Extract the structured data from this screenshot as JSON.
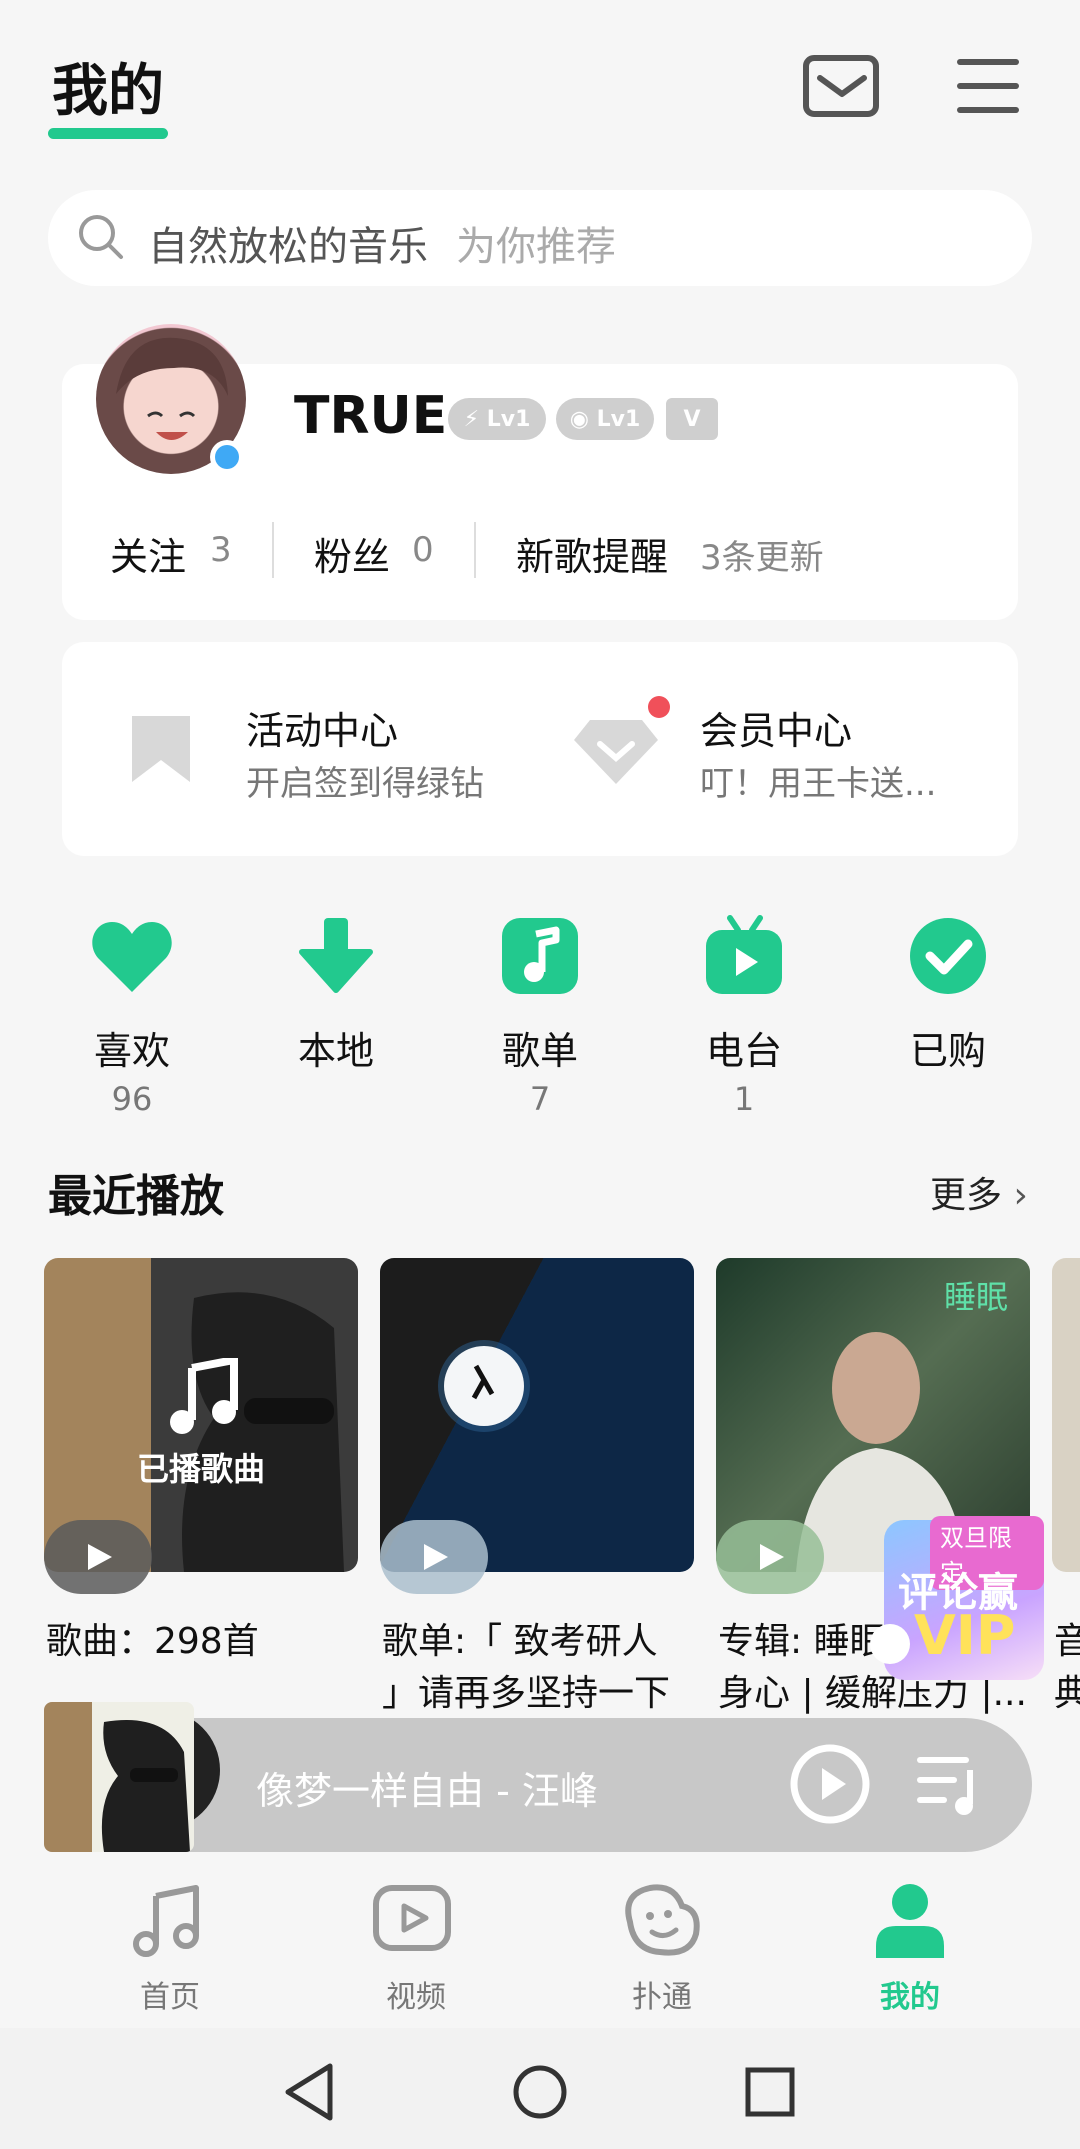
{
  "header": {
    "title": "我的"
  },
  "search": {
    "text": "自然放松的音乐",
    "hint": "为你推荐"
  },
  "profile": {
    "username": "TRUE",
    "badges": [
      "Lv1",
      "Lv1",
      "V"
    ],
    "stats": [
      {
        "label": "关注",
        "value": "3"
      },
      {
        "label": "粉丝",
        "value": "0"
      },
      {
        "label": "新歌提醒",
        "value": "3条更新"
      }
    ]
  },
  "centers": [
    {
      "title": "活动中心",
      "subtitle": "开启签到得绿钻",
      "icon": "bookmark-icon"
    },
    {
      "title": "会员中心",
      "subtitle": "叮！用王卡送...",
      "icon": "diamond-icon"
    }
  ],
  "shortcuts": [
    {
      "label": "喜欢",
      "count": "96",
      "icon": "heart-icon"
    },
    {
      "label": "本地",
      "count": "",
      "icon": "download-icon"
    },
    {
      "label": "歌单",
      "count": "7",
      "icon": "music-note-icon"
    },
    {
      "label": "电台",
      "count": "1",
      "icon": "radio-tv-icon"
    },
    {
      "label": "已购",
      "count": "",
      "icon": "check-circle-icon"
    }
  ],
  "recent": {
    "title": "最近播放",
    "more": "更多",
    "items": [
      {
        "cover_text": "已播歌曲",
        "line1": "歌曲：298首",
        "line2": ""
      },
      {
        "cover_text": "",
        "line1": "歌单:「 致考研人",
        "line2": "」请再多坚持一下"
      },
      {
        "cover_text": "睡眠",
        "line1": "专辑: 睡眠",
        "line2": "身心 | 缓解压力 |..."
      },
      {
        "cover_text": "",
        "line1": "音",
        "line2": "典"
      }
    ]
  },
  "promo": {
    "tag": "双旦限定",
    "line1": "评论赢",
    "line2": "VIP"
  },
  "player": {
    "now_playing": "像梦一样自由 - 汪峰"
  },
  "nav": [
    {
      "label": "首页",
      "icon": "music-note-outline-icon",
      "active": false
    },
    {
      "label": "视频",
      "icon": "video-play-icon",
      "active": false
    },
    {
      "label": "扑通",
      "icon": "smiley-bubble-icon",
      "active": false
    },
    {
      "label": "我的",
      "icon": "person-icon",
      "active": true
    }
  ],
  "colors": {
    "accent": "#22c98e",
    "notify": "#f0505a"
  }
}
